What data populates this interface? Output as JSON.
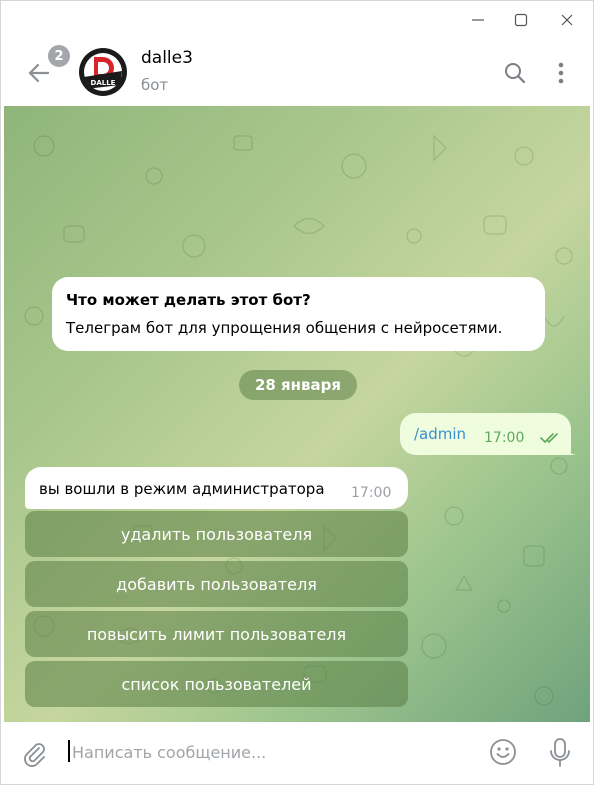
{
  "window": {
    "controls": [
      "minimize",
      "maximize",
      "close"
    ]
  },
  "header": {
    "unread_count": "2",
    "avatar_text": "DALLE",
    "title": "dalle3",
    "subtitle": "бот",
    "icons": [
      "back-arrow-icon",
      "search-icon",
      "more-vertical-icon"
    ]
  },
  "intro": {
    "title": "Что может делать этот бот?",
    "text": "Телеграм бот для упрощения общения с нейросетями."
  },
  "date_separator": "28 января",
  "messages": [
    {
      "direction": "outgoing",
      "text": "/admin",
      "time": "17:00",
      "status": "read"
    },
    {
      "direction": "incoming",
      "text": "вы вошли в режим администратора",
      "time": "17:00"
    }
  ],
  "keyboard": [
    {
      "label": "удалить пользователя"
    },
    {
      "label": "добавить пользователя"
    },
    {
      "label": "повысить лимит пользователя"
    },
    {
      "label": "список пользователей"
    }
  ],
  "composer": {
    "placeholder": "Написать сообщение...",
    "icons": [
      "paperclip-icon",
      "emoji-icon",
      "microphone-icon"
    ]
  },
  "colors": {
    "outgoing_bubble": "#effdde",
    "link": "#3a8fd0",
    "read_check": "#5fa85c",
    "keyboard_button": "#5a7d46"
  }
}
